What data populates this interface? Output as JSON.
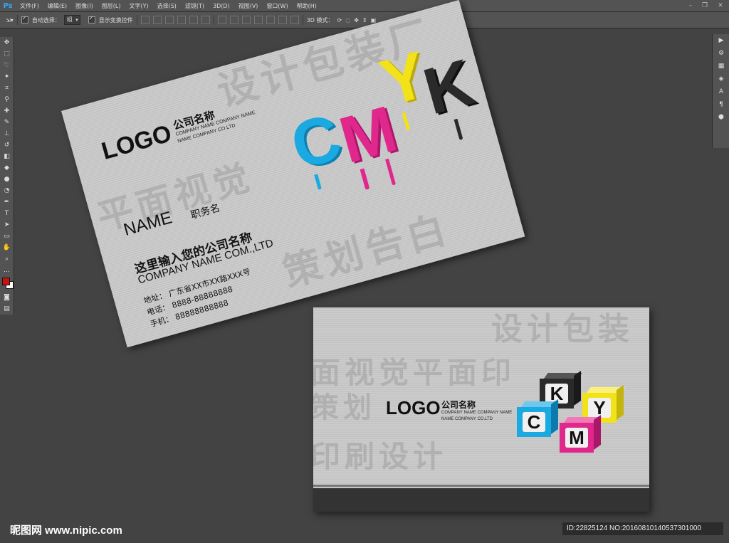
{
  "app": {
    "logo": "Ps"
  },
  "menu": [
    "文件(F)",
    "编辑(E)",
    "图像(I)",
    "图层(L)",
    "文字(Y)",
    "选择(S)",
    "滤镜(T)",
    "3D(D)",
    "视图(V)",
    "窗口(W)",
    "帮助(H)"
  ],
  "options_bar": {
    "auto_select_label": "自动选择：",
    "auto_select_value": "组",
    "show_transform_label": "显示变换控件",
    "mode_3d_label": "3D 模式："
  },
  "front_card": {
    "logo": "LOGO",
    "company_name_cn": "公司名称",
    "company_name_en_1": "COMPANY NAME COMPANY NAME",
    "company_name_en_2": "NAME COMPANY CO.LTD",
    "cmyk_letters": [
      "C",
      "M",
      "Y",
      "K"
    ],
    "person_name": "NAME",
    "job_title": "职务名",
    "company_full_cn": "这里输入您的公司名称",
    "company_full_en": "COMPANY NAME COM.,LTD",
    "address_label": "地址：",
    "address_value": "广东省XX市XX路XXX号",
    "phone_label": "电话：",
    "phone_value": "8888-88888888",
    "mobile_label": "手机：",
    "mobile_value": "88888888888",
    "watermark_1": "设计包装厂",
    "watermark_2": "平面视觉",
    "watermark_3": "策划告白"
  },
  "back_card": {
    "logo": "LOGO",
    "company_name_cn": "公司名称",
    "company_name_en_1": "COMPANY NAME COMPANY NAME",
    "company_name_en_2": "NAME COMPANY CO.LTD",
    "cube_letters": {
      "k": "K",
      "y": "Y",
      "c": "C",
      "m": "M"
    },
    "watermark_1": "设计包装",
    "watermark_2": "面视觉平面印",
    "watermark_3": "策划",
    "watermark_4": "印刷设计"
  },
  "colors": {
    "cyan": "#1aa9e0",
    "magenta": "#e0288c",
    "yellow": "#f2e219",
    "black": "#2a2a2a"
  },
  "footer": {
    "site": "昵图网 www.nipic.com",
    "id_text": "ID:22825124 NO:20160810140537301000"
  }
}
